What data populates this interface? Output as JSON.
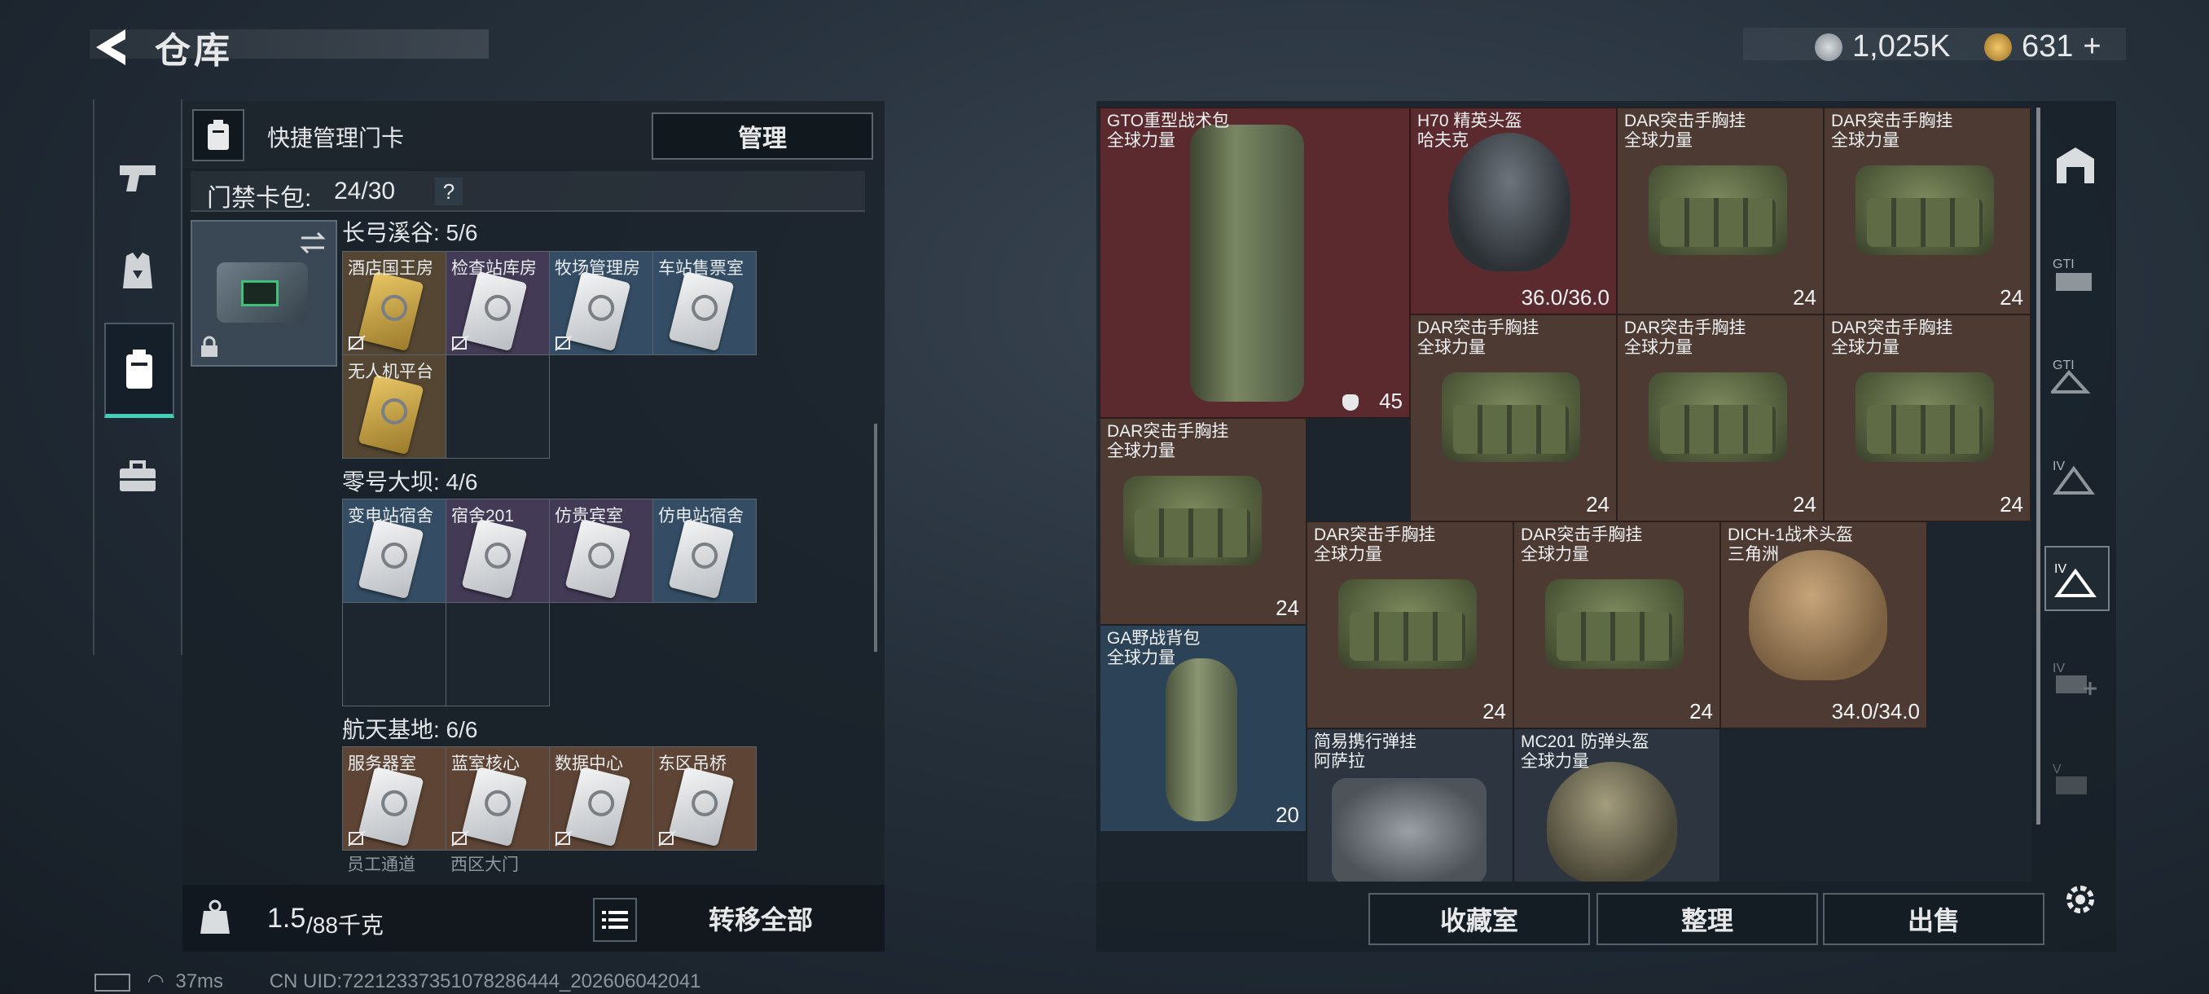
{
  "header": {
    "title": "仓库",
    "currency_1": "1,025K",
    "currency_2": "631",
    "currency_2_plus": "+"
  },
  "keycard_panel": {
    "header_label": "快捷管理门卡",
    "manage_button": "管理",
    "count_label": "门禁卡包:",
    "count_value": "24/30",
    "help_symbol": "?",
    "sections": [
      {
        "title": "长弓溪谷: 5/6",
        "cards": [
          "酒店国王房",
          "检查站库房",
          "牧场管理房",
          "车站售票室",
          "无人机平台"
        ]
      },
      {
        "title": "零号大坝: 4/6",
        "cards": [
          "变电站宿舍",
          "宿舍201",
          "仿贵宾室",
          "仿电站宿舍"
        ]
      },
      {
        "title": "航天基地: 6/6",
        "cards": [
          "服务器室",
          "蓝室核心",
          "数据中心",
          "东区吊桥",
          "员工通道",
          "西区大门"
        ]
      }
    ]
  },
  "left_footer": {
    "weight_value": "1.5",
    "weight_capacity": "/88千克",
    "transfer_all": "转移全部"
  },
  "items": [
    {
      "name": "GTO重型战术包",
      "sub": "全球力量",
      "value": "45",
      "rarity": "red"
    },
    {
      "name": "H70 精英头盔",
      "sub": "哈夫克",
      "value": "36.0/36.0",
      "rarity": "red"
    },
    {
      "name": "DAR突击手胸挂",
      "sub": "全球力量",
      "value": "24",
      "rarity": "brown"
    },
    {
      "name": "DAR突击手胸挂",
      "sub": "全球力量",
      "value": "24",
      "rarity": "brown"
    },
    {
      "name": "DAR突击手胸挂",
      "sub": "全球力量",
      "value": "24",
      "rarity": "brown"
    },
    {
      "name": "DAR突击手胸挂",
      "sub": "全球力量",
      "value": "24",
      "rarity": "brown"
    },
    {
      "name": "DAR突击手胸挂",
      "sub": "全球力量",
      "value": "24",
      "rarity": "brown"
    },
    {
      "name": "DAR突击手胸挂",
      "sub": "全球力量",
      "value": "24",
      "rarity": "brown"
    },
    {
      "name": "DAR突击手胸挂",
      "sub": "全球力量",
      "value": "24",
      "rarity": "brown"
    },
    {
      "name": "DAR突击手胸挂",
      "sub": "全球力量",
      "value": "24",
      "rarity": "brown"
    },
    {
      "name": "DICH-1战术头盔",
      "sub": "三角洲",
      "value": "34.0/34.0",
      "rarity": "brown"
    },
    {
      "name": "GA野战背包",
      "sub": "全球力量",
      "value": "20",
      "rarity": "blue"
    },
    {
      "name": "简易携行弹挂",
      "sub": "阿萨拉",
      "value": "",
      "rarity": "gray"
    },
    {
      "name": "MC201 防弹头盔",
      "sub": "全球力量",
      "value": "",
      "rarity": "gray"
    }
  ],
  "bottom_buttons": {
    "collection": "收藏室",
    "sort": "整理",
    "sell": "出售"
  },
  "status": {
    "ping": "37ms",
    "uid": "CN UID:72212337351078286444_202606042041"
  },
  "colors": {
    "accent": "#3fd0b5",
    "rarity_red": "#5b2a2e",
    "rarity_brown": "#4d3a33",
    "rarity_blue": "#2c4257"
  }
}
